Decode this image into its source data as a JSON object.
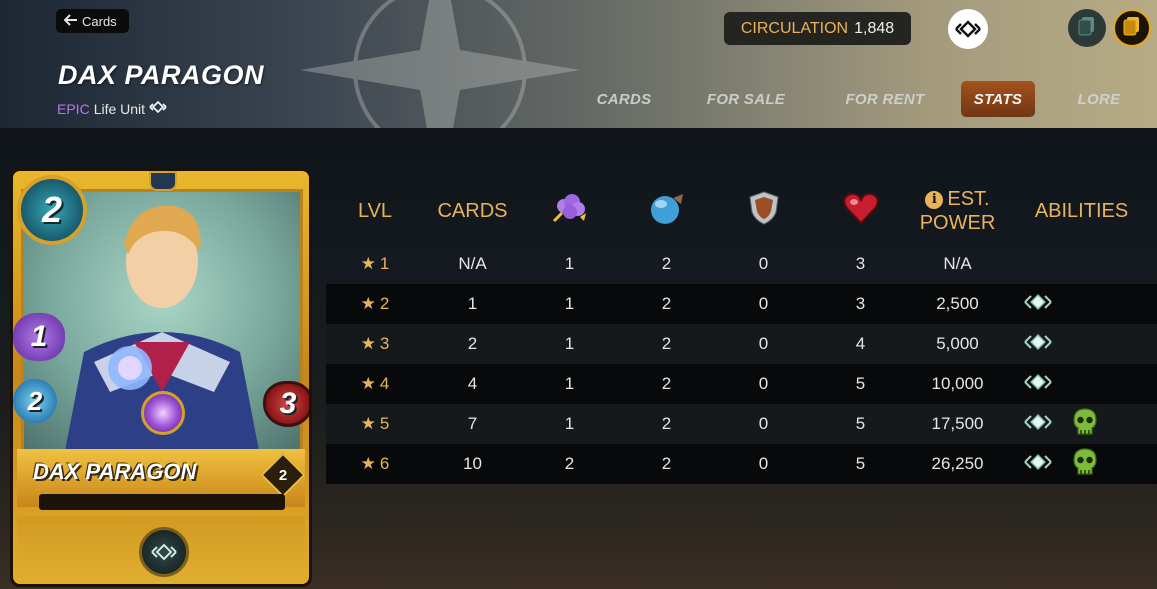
{
  "nav": {
    "back_label": "Cards"
  },
  "card_header": {
    "name": "DAX PARAGON",
    "rarity": "EPIC",
    "unit_type": "Life Unit"
  },
  "circulation": {
    "label": "CIRCULATION",
    "value": "1,848"
  },
  "tabs": [
    {
      "label": "CARDS",
      "active": false
    },
    {
      "label": "FOR SALE",
      "active": false
    },
    {
      "label": "FOR RENT",
      "active": false
    },
    {
      "label": "STATS",
      "active": true
    },
    {
      "label": "LORE",
      "active": false
    }
  ],
  "card_image": {
    "mana": "2",
    "magic": "1",
    "speed": "2",
    "health": "3",
    "name": "DAX PARAGON",
    "level": "2"
  },
  "table": {
    "headers": {
      "lvl": "LVL",
      "cards": "CARDS",
      "magic": "magic-icon",
      "speed": "speed-icon",
      "armor": "armor-icon",
      "health": "health-icon",
      "power_line1": "EST.",
      "power_line2": "POWER",
      "abilities": "ABILITIES"
    },
    "rows": [
      {
        "lvl": "1",
        "cards": "N/A",
        "magic": "1",
        "speed": "2",
        "armor": "0",
        "health": "3",
        "power": "N/A",
        "abilities": []
      },
      {
        "lvl": "2",
        "cards": "1",
        "magic": "1",
        "speed": "2",
        "armor": "0",
        "health": "3",
        "power": "2,500",
        "abilities": [
          "diamond-ability-icon"
        ]
      },
      {
        "lvl": "3",
        "cards": "2",
        "magic": "1",
        "speed": "2",
        "armor": "0",
        "health": "4",
        "power": "5,000",
        "abilities": [
          "diamond-ability-icon"
        ]
      },
      {
        "lvl": "4",
        "cards": "4",
        "magic": "1",
        "speed": "2",
        "armor": "0",
        "health": "5",
        "power": "10,000",
        "abilities": [
          "diamond-ability-icon"
        ]
      },
      {
        "lvl": "5",
        "cards": "7",
        "magic": "1",
        "speed": "2",
        "armor": "0",
        "health": "5",
        "power": "17,500",
        "abilities": [
          "diamond-ability-icon",
          "skull-ability-icon"
        ]
      },
      {
        "lvl": "6",
        "cards": "10",
        "magic": "2",
        "speed": "2",
        "armor": "0",
        "health": "5",
        "power": "26,250",
        "abilities": [
          "diamond-ability-icon",
          "skull-ability-icon"
        ]
      }
    ]
  },
  "colors": {
    "accent_gold": "#e9b35c",
    "rarity_epic": "#b574f0",
    "active_tab": "#a44b13"
  }
}
